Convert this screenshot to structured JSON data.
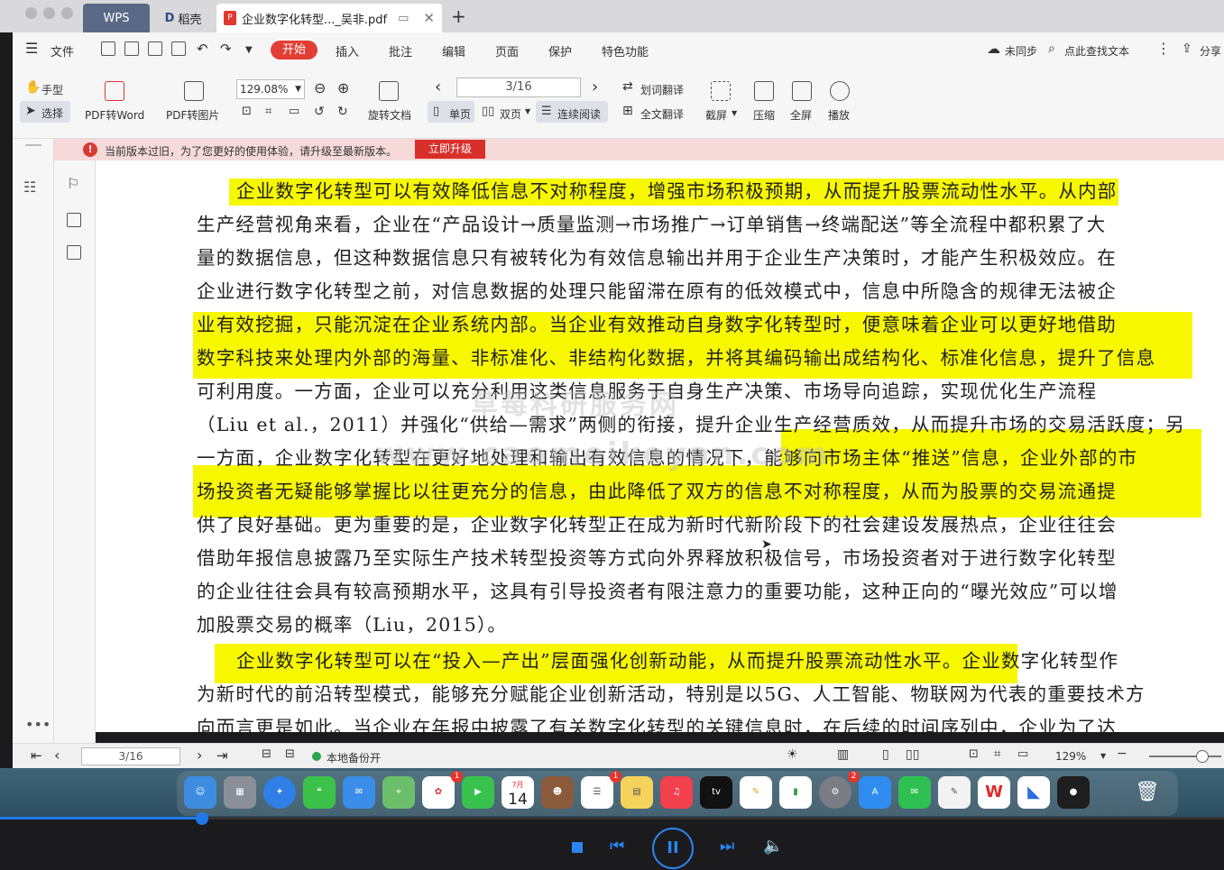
{
  "app": {
    "tabs": [
      {
        "label": "WPS"
      },
      {
        "label": "稻壳"
      },
      {
        "label": "企业数字化转型..._吴非.pdf"
      }
    ]
  },
  "menu": {
    "file": "文件",
    "items": [
      "开始",
      "插入",
      "批注",
      "编辑",
      "页面",
      "保护",
      "特色功能"
    ],
    "sync": "未同步",
    "find": "点此查找文本",
    "share": "分享"
  },
  "toolbar": {
    "hand": "手型",
    "select": "选择",
    "pdf_to_word": "PDF转Word",
    "pdf_to_image": "PDF转图片",
    "zoom": "129.08%",
    "rotate": "旋转文档",
    "page": "3/16",
    "single": "单页",
    "double": "双页",
    "continuous": "连续阅读",
    "word_translate": "划词翻译",
    "full_translate": "全文翻译",
    "screenshot": "截屏",
    "compress": "压缩",
    "fullscreen": "全屏",
    "play": "播放"
  },
  "notice": {
    "text": "当前版本过旧，为了您更好的使用体验，请升级至最新版本。",
    "button": "立即升级"
  },
  "document": {
    "lines": [
      "企业数字化转型可以有效降低信息不对称程度，增强市场积极预期，从而提升股票流动性水平。从内部",
      "生产经营视角来看，企业在“产品设计→质量监测→市场推广→订单销售→终端配送”等全流程中都积累了大",
      "量的数据信息，但这种数据信息只有被转化为有效信息输出并用于企业生产决策时，才能产生积极效应。在",
      "企业进行数字化转型之前，对信息数据的处理只能留滞在原有的低效模式中，信息中所隐含的规律无法被企",
      "业有效挖掘，只能沉淀在企业系统内部。当企业有效推动自身数字化转型时，便意味着企业可以更好地借助",
      "数字科技来处理内外部的海量、非标准化、非结构化数据，并将其编码输出成结构化、标准化信息，提升了信息",
      "可利用度。一方面，企业可以充分利用这类信息服务于自身生产决策、市场导向追踪，实现优化生产流程",
      "（Liu et al.，2011）并强化“供给—需求”两侧的衔接，提升企业生产经营质效，从而提升市场的交易活跃度；另",
      "一方面，企业数字化转型在更好地处理和输出有效信息的情况下，能够向市场主体“推送”信息，企业外部的市",
      "场投资者无疑能够掌握比以往更充分的信息，由此降低了双方的信息不对称程度，从而为股票的交易流通提",
      "供了良好基础。更为重要的是，企业数字化转型正在成为新时代新阶段下的社会建设发展热点，企业往往会",
      "借助年报信息披露乃至实际生产技术转型投资等方式向外界释放积极信号，市场投资者对于进行数字化转型",
      "的企业往往会具有较高预期水平，这具有引导投资者有限注意力的重要功能，这种正向的“曝光效应”可以增",
      "加股票交易的概率（Liu，2015）。",
      "企业数字化转型可以在“投入—产出”层面强化创新动能，从而提升股票流动性水平。企业数字化转型作",
      "为新时代的前沿转型模式，能够充分赋能企业创新活动，特别是以5G、人工智能、物联网为代表的重要技术方",
      "向而言更是如此。当企业在年报中披露了有关数字化转型的关键信息时，在后续的时间序列中，企业为了达"
    ],
    "watermark_1": "草莓科研服务网",
    "watermark_2": "www.caomeikeyan.com"
  },
  "statusbar": {
    "page": "3/16",
    "backup": "本地备份开",
    "zoom": "129%"
  },
  "dock": {
    "calendar_month": "7月",
    "calendar_day": "14",
    "tv": "tv",
    "badge_1": "1",
    "badge_2": "1",
    "badge_3": "2"
  },
  "player": {
    "progress_percent": 16.5
  }
}
